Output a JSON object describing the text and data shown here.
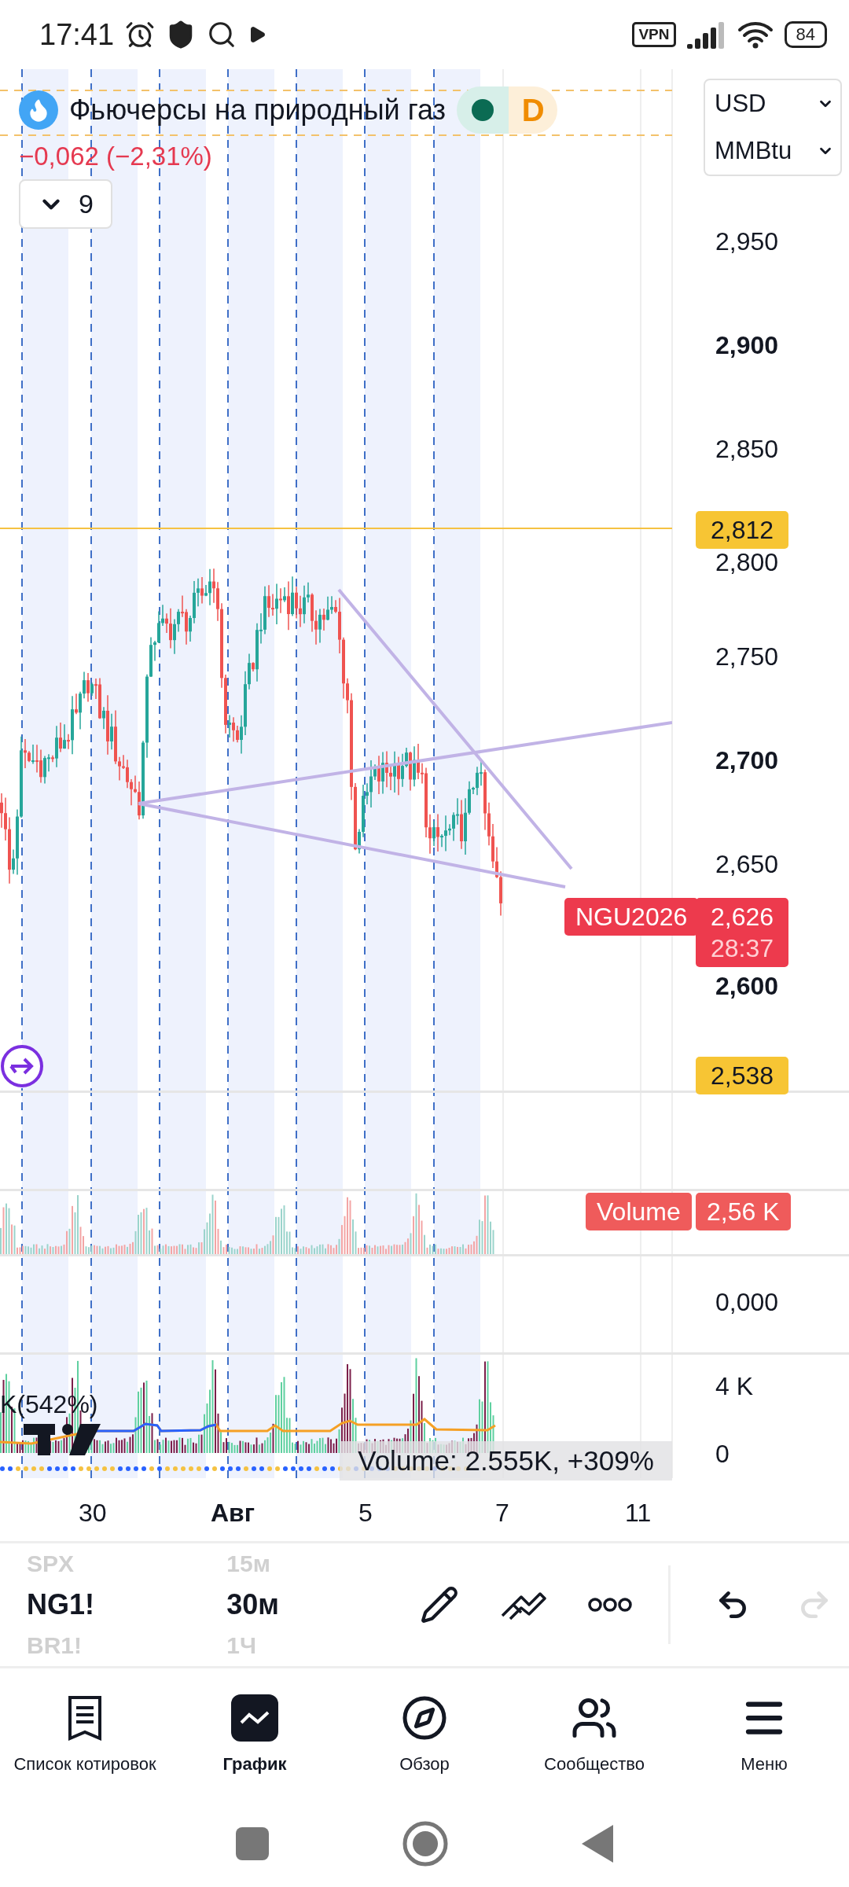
{
  "status_bar": {
    "time": "17:41",
    "vpn": "VPN",
    "battery": "84"
  },
  "legend": {
    "title": "Фьючерсы на природный газ",
    "session": "D",
    "change": "−0,062 (−2,31%)",
    "indicators_count": "9"
  },
  "unit_selectors": [
    {
      "label": "USD"
    },
    {
      "label": "MMBtu"
    }
  ],
  "price_axis": [
    {
      "label": "2,950",
      "bold": false
    },
    {
      "label": "2,900",
      "bold": true
    },
    {
      "label": "2,850",
      "bold": false
    },
    {
      "label": "2,800",
      "bold": false
    },
    {
      "label": "2,750",
      "bold": false
    },
    {
      "label": "2,700",
      "bold": true
    },
    {
      "label": "2,650",
      "bold": false
    },
    {
      "label": "2,600",
      "bold": true
    }
  ],
  "price_badges": [
    {
      "kind": "alert",
      "value": "2,812"
    },
    {
      "kind": "last",
      "symbol": "NGU2026",
      "value": "2,626",
      "countdown": "28:37"
    },
    {
      "kind": "alert",
      "value": "2,538"
    }
  ],
  "volume_pane": {
    "legend": "Volume",
    "value": "2,56 K"
  },
  "blank_pane": {
    "axis": "0,000"
  },
  "indicator_pane": {
    "label": "K(542%)",
    "axis": [
      "4 K",
      "0"
    ],
    "readout": "Volume: 2.555K, +309%"
  },
  "time_axis": [
    {
      "label": "30",
      "bold": false
    },
    {
      "label": "Авг",
      "bold": true
    },
    {
      "label": "5",
      "bold": false
    },
    {
      "label": "7",
      "bold": false
    },
    {
      "label": "11",
      "bold": false
    }
  ],
  "toolbar": {
    "symbols": [
      {
        "label": "SPX",
        "selected": false
      },
      {
        "label": "NG1!",
        "selected": true
      },
      {
        "label": "BR1!",
        "selected": false
      }
    ],
    "intervals": [
      {
        "label": "15м",
        "selected": false
      },
      {
        "label": "30м",
        "selected": true
      },
      {
        "label": "1Ч",
        "selected": false
      }
    ],
    "redo_disabled": true
  },
  "nav": [
    {
      "label": "Список котировок",
      "selected": false
    },
    {
      "label": "График",
      "selected": true
    },
    {
      "label": "Обзор",
      "selected": false
    },
    {
      "label": "Сообщество",
      "selected": false
    },
    {
      "label": "Меню",
      "selected": false
    }
  ]
}
